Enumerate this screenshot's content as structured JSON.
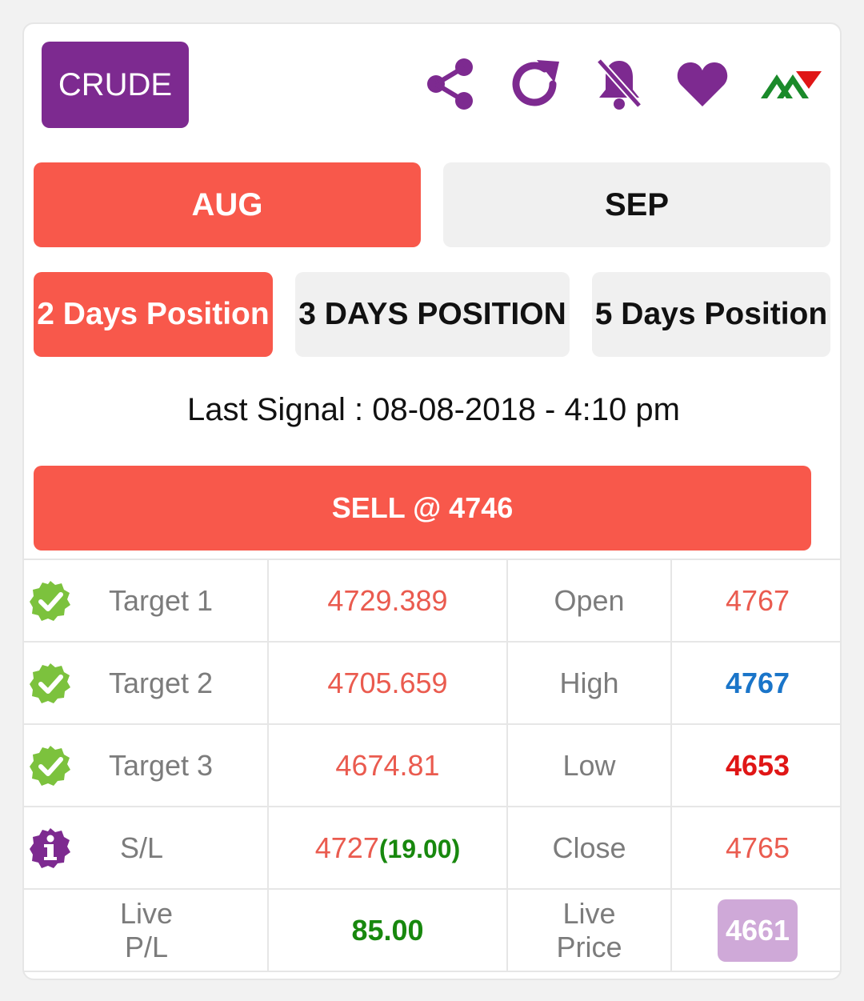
{
  "header": {
    "symbol": "CRUDE",
    "icons": [
      "share-icon",
      "refresh-icon",
      "bell-off-icon",
      "heart-icon",
      "logo-icon"
    ],
    "accent_color": "#7d2a90"
  },
  "months": [
    {
      "label": "AUG",
      "active": true
    },
    {
      "label": "SEP",
      "active": false
    }
  ],
  "positions": [
    {
      "label": "2 Days Position",
      "active": true
    },
    {
      "label": "3 DAYS POSITION",
      "active": false
    },
    {
      "label": "5 Days Position",
      "active": false
    }
  ],
  "signal": {
    "text": "Last Signal : 08-08-2018 - 4:10 pm",
    "action": "SELL @ 4746"
  },
  "rows": [
    {
      "icon": "check-badge-icon",
      "label": "Target 1",
      "value": "4729.389",
      "stat_label": "Open",
      "stat_value": "4767"
    },
    {
      "icon": "check-badge-icon",
      "label": "Target 2",
      "value": "4705.659",
      "stat_label": "High",
      "stat_value": "4767"
    },
    {
      "icon": "check-badge-icon",
      "label": "Target 3",
      "value": "4674.81",
      "stat_label": "Low",
      "stat_value": "4653"
    },
    {
      "icon": "info-badge-icon",
      "label": "S/L",
      "value": "4727",
      "value_extra": "(19.00)",
      "stat_label": "Close",
      "stat_value": "4765"
    }
  ],
  "live": {
    "pl_label_line1": "Live",
    "pl_label_line2": "P/L",
    "pl_value": "85.00",
    "price_label_line1": "Live",
    "price_label_line2": "Price",
    "price_value": "4661"
  },
  "colors": {
    "active_tab": "#f8584b",
    "check_green": "#7cc23d",
    "high_blue": "#1a75c9",
    "low_red": "#e01616",
    "pl_green": "#18880e",
    "live_price_badge": "#cfa9d8"
  }
}
